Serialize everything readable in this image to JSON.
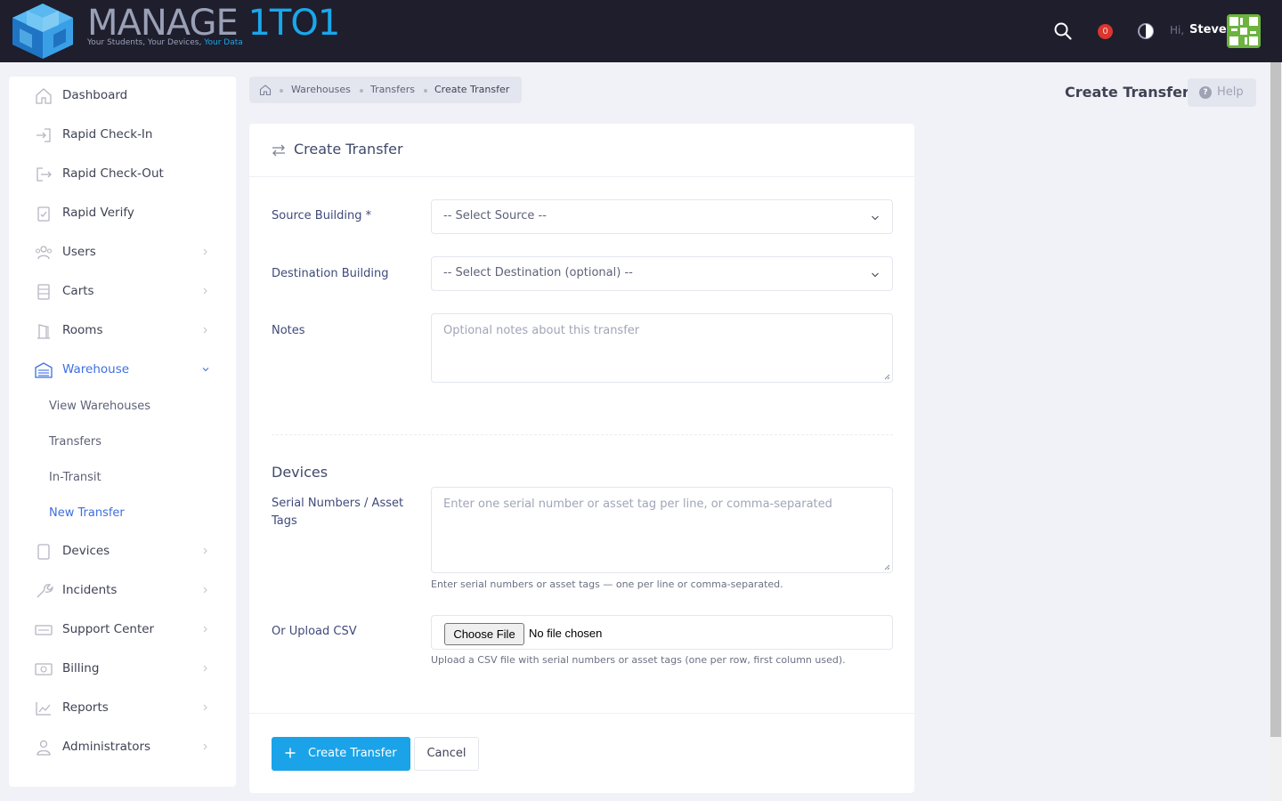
{
  "app": {
    "logo_main": "MANAGE ",
    "logo_accent": "1TO1",
    "tagline_main": "Your Students, Your Devices, ",
    "tagline_accent": "Your Data"
  },
  "topbar": {
    "notification_count": "0",
    "greeting": "Hi,",
    "user_name": "Steve"
  },
  "sidebar": {
    "items": [
      {
        "label": "Dashboard",
        "icon": "home-icon"
      },
      {
        "label": "Rapid Check-In",
        "icon": "login-icon"
      },
      {
        "label": "Rapid Check-Out",
        "icon": "logout-icon"
      },
      {
        "label": "Rapid Verify",
        "icon": "clipboard-check-icon"
      },
      {
        "label": "Users",
        "icon": "users-icon"
      },
      {
        "label": "Carts",
        "icon": "cart-icon"
      },
      {
        "label": "Rooms",
        "icon": "door-icon"
      },
      {
        "label": "Warehouse",
        "icon": "warehouse-icon"
      },
      {
        "label": "Devices",
        "icon": "tablet-icon"
      },
      {
        "label": "Incidents",
        "icon": "wrench-icon"
      },
      {
        "label": "Support Center",
        "icon": "ticket-icon"
      },
      {
        "label": "Billing",
        "icon": "money-icon"
      },
      {
        "label": "Reports",
        "icon": "chart-icon"
      },
      {
        "label": "Administrators",
        "icon": "admin-icon"
      }
    ],
    "warehouse_sub": [
      "View Warehouses",
      "Transfers",
      "In-Transit",
      "New Transfer"
    ]
  },
  "breadcrumb": [
    "Warehouses",
    "Transfers",
    "Create Transfer"
  ],
  "header": {
    "title": "Create Transfer",
    "help_label": "Help"
  },
  "form": {
    "card_title": "Create Transfer",
    "source_label": "Source Building *",
    "source_value": "-- Select Source --",
    "dest_label": "Destination Building",
    "dest_value": "-- Select Destination (optional) --",
    "notes_label": "Notes",
    "notes_placeholder": "Optional notes about this transfer",
    "devices_title": "Devices",
    "serials_label_1": "Serial Numbers / Asset",
    "serials_label_2": "Tags",
    "serials_placeholder": "Enter one serial number or asset tag per line, or comma-separated",
    "serials_hint": "Enter serial numbers or asset tags — one per line or comma-separated.",
    "csv_label": "Or Upload CSV",
    "file_button": "Choose File",
    "file_status": "No file chosen",
    "csv_hint": "Upload a CSV file with serial numbers or asset tags (one per row, first column used).",
    "submit_label": "Create Transfer",
    "cancel_label": "Cancel"
  },
  "colors": {
    "topbar": "#1e1e2d",
    "accent": "#1aa3e8",
    "active_nav": "#3d6fe0",
    "badge": "#d9362e"
  }
}
